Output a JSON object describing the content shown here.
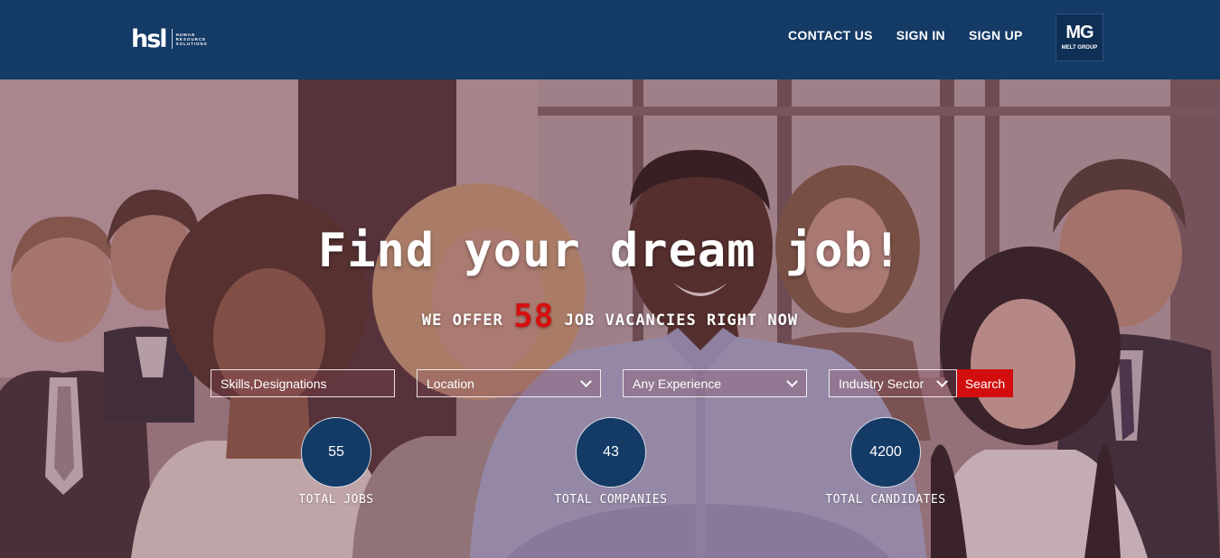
{
  "header": {
    "logo": {
      "mark": "hsl",
      "words": [
        "HUMAN",
        "RESOURCE",
        "SOLUTIONS"
      ]
    },
    "nav": {
      "contact": "CONTACT US",
      "signin": "SIGN IN",
      "signup": "SIGN UP"
    },
    "partner": {
      "mark": "MG",
      "text": "MELT GROUP"
    },
    "background_color": "#143a66"
  },
  "hero": {
    "headline": "Find your dream job!",
    "offer_prefix": "WE OFFER",
    "offer_count": "58",
    "offer_suffix": "JOB VACANCIES RIGHT NOW",
    "accent_color": "#d50f0f"
  },
  "search": {
    "skills_placeholder": "Skills,Designations",
    "location": "Location",
    "experience": "Any Experience",
    "industry": "Industry Sector",
    "button": "Search"
  },
  "stats": [
    {
      "value": "55",
      "label": "TOTAL JOBS"
    },
    {
      "value": "43",
      "label": "TOTAL COMPANIES"
    },
    {
      "value": "4200",
      "label": "TOTAL CANDIDATES"
    }
  ]
}
